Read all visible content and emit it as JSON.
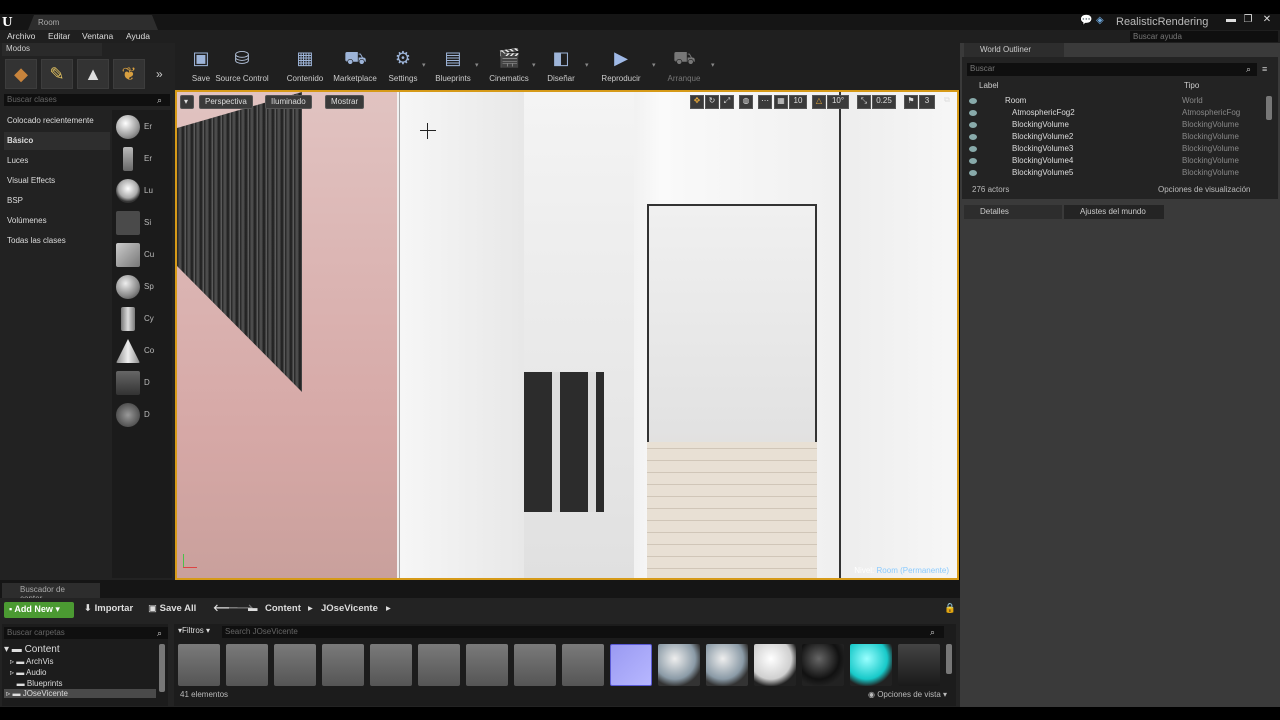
{
  "window": {
    "tab": "Room",
    "project": "RealisticRendering",
    "controls": [
      "▬",
      "❐",
      "✕"
    ],
    "help_search_placeholder": "Buscar ayuda"
  },
  "menu": [
    "Archivo",
    "Editar",
    "Ventana",
    "Ayuda"
  ],
  "modes": {
    "tab": "Modos",
    "search_placeholder": "Buscar clases",
    "categories": [
      "Colocado recientemente",
      "Básico",
      "Luces",
      "Visual Effects",
      "BSP",
      "Volúmenes",
      "Todas las clases"
    ],
    "place_items": [
      {
        "label": "Er",
        "icon": "sphere-icon"
      },
      {
        "label": "Er",
        "icon": "pawn-icon"
      },
      {
        "label": "Lu",
        "icon": "bulb-icon"
      },
      {
        "label": "Si",
        "icon": "volume-icon"
      },
      {
        "label": "Cu",
        "icon": "cube-icon"
      },
      {
        "label": "Sp",
        "icon": "sphere-icon"
      },
      {
        "label": "Cy",
        "icon": "cylinder-icon"
      },
      {
        "label": "Co",
        "icon": "cone-icon"
      },
      {
        "label": "D",
        "icon": "decal-icon"
      },
      {
        "label": "D",
        "icon": "decal-icon"
      }
    ]
  },
  "toolbar": [
    {
      "label": "Save",
      "icon": "save-icon"
    },
    {
      "label": "Source Control",
      "icon": "source-control-icon"
    },
    {
      "label": "Contenido",
      "icon": "content-icon"
    },
    {
      "label": "Marketplace",
      "icon": "marketplace-icon"
    },
    {
      "label": "Settings",
      "icon": "settings-icon"
    },
    {
      "label": "Blueprints",
      "icon": "blueprints-icon"
    },
    {
      "label": "Cinematics",
      "icon": "cinematics-icon"
    },
    {
      "label": "Diseñar",
      "icon": "build-icon"
    },
    {
      "label": "Reproducir",
      "icon": "play-icon"
    },
    {
      "label": "Arranque",
      "icon": "launch-icon"
    }
  ],
  "viewport": {
    "perspective": "Perspectiva",
    "lit": "Iluminado",
    "show": "Mostrar",
    "grid_snap": "10",
    "rotation_snap": "10°",
    "scale_snap": "0.25",
    "camera_speed": "3",
    "level_prefix": "Nivel:",
    "level_name": "Room (Permanente)"
  },
  "outliner": {
    "tab": "World Outliner",
    "search_placeholder": "Buscar",
    "col_label": "Label",
    "col_type": "Tipo",
    "rows": [
      {
        "label": "Room",
        "type": "World"
      },
      {
        "label": "AtmosphericFog2",
        "type": "AtmosphericFog"
      },
      {
        "label": "BlockingVolume",
        "type": "BlockingVolume"
      },
      {
        "label": "BlockingVolume2",
        "type": "BlockingVolume"
      },
      {
        "label": "BlockingVolume3",
        "type": "BlockingVolume"
      },
      {
        "label": "BlockingVolume4",
        "type": "BlockingVolume"
      },
      {
        "label": "BlockingVolume5",
        "type": "BlockingVolume"
      }
    ],
    "actor_count": "276 actors",
    "view_options": "Opciones de visualización"
  },
  "details": {
    "tab": "Detalles",
    "world_tab": "Ajustes del mundo"
  },
  "content_browser": {
    "tab": "Buscador de conter",
    "add_new": "Add New",
    "import": "Importar",
    "save_all": "Save All",
    "path": [
      "Content",
      "JOseVicente"
    ],
    "folder_search_placeholder": "Buscar carpetas",
    "asset_search_placeholder": "Search JOseVicente",
    "filters": "Filtros",
    "tree": [
      "Content",
      "ArchVis",
      "Audio",
      "Blueprints",
      "JOseVicente"
    ],
    "item_count": "41 elementos",
    "view_options": "Opciones de vista"
  },
  "colors": {
    "accent_orange": "#d69a18",
    "add_new_green": "#4b9a32",
    "link_blue": "#8acbff"
  }
}
